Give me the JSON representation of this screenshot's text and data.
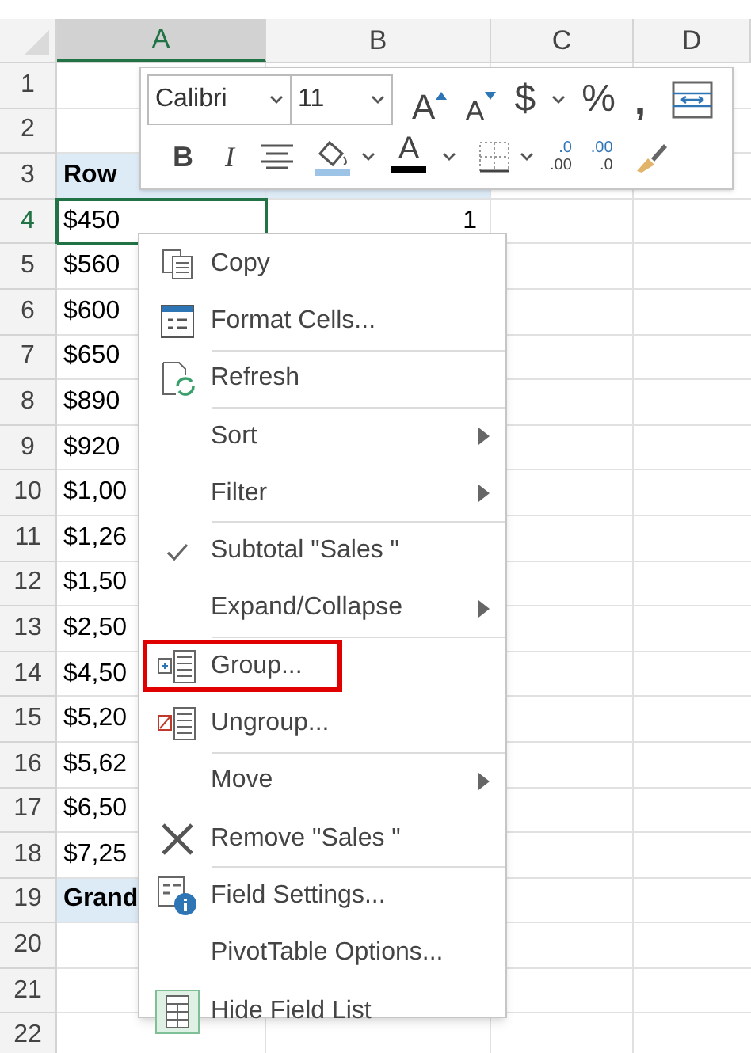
{
  "columns": [
    {
      "label": "A",
      "selected": true
    },
    {
      "label": "B",
      "selected": false
    },
    {
      "label": "C",
      "selected": false
    },
    {
      "label": "D",
      "selected": false
    }
  ],
  "rows": [
    {
      "number": "1",
      "kind": "plain",
      "selected": false
    },
    {
      "number": "2",
      "kind": "plain",
      "selected": false
    },
    {
      "number": "3",
      "kind": "heading",
      "selected": false,
      "a": "Row"
    },
    {
      "number": "4",
      "kind": "plain",
      "selected": true,
      "a": "$450",
      "b": "1"
    },
    {
      "number": "5",
      "kind": "plain",
      "selected": false,
      "a": "$560"
    },
    {
      "number": "6",
      "kind": "plain",
      "selected": false,
      "a": "$600"
    },
    {
      "number": "7",
      "kind": "plain",
      "selected": false,
      "a": "$650"
    },
    {
      "number": "8",
      "kind": "plain",
      "selected": false,
      "a": "$890"
    },
    {
      "number": "9",
      "kind": "plain",
      "selected": false,
      "a": "$920"
    },
    {
      "number": "10",
      "kind": "plain",
      "selected": false,
      "a": "$1,00"
    },
    {
      "number": "11",
      "kind": "plain",
      "selected": false,
      "a": "$1,26"
    },
    {
      "number": "12",
      "kind": "plain",
      "selected": false,
      "a": "$1,50"
    },
    {
      "number": "13",
      "kind": "plain",
      "selected": false,
      "a": "$2,50"
    },
    {
      "number": "14",
      "kind": "plain",
      "selected": false,
      "a": "$4,50"
    },
    {
      "number": "15",
      "kind": "plain",
      "selected": false,
      "a": "$5,20"
    },
    {
      "number": "16",
      "kind": "plain",
      "selected": false,
      "a": "$5,62"
    },
    {
      "number": "17",
      "kind": "plain",
      "selected": false,
      "a": "$6,50"
    },
    {
      "number": "18",
      "kind": "plain",
      "selected": false,
      "a": "$7,25"
    },
    {
      "number": "19",
      "kind": "heading",
      "selected": false,
      "a": "Grand"
    },
    {
      "number": "20",
      "kind": "plain",
      "selected": false
    },
    {
      "number": "21",
      "kind": "plain",
      "selected": false
    },
    {
      "number": "22",
      "kind": "plain",
      "selected": false
    }
  ],
  "mini_toolbar": {
    "font": "Calibri",
    "size": "11",
    "row_1": [
      {
        "kind": "grow",
        "label": "A"
      },
      {
        "kind": "shrink",
        "label": "A"
      },
      {
        "kind": "text",
        "label": "$"
      },
      {
        "kind": "caret"
      },
      {
        "kind": "text",
        "label": "%"
      },
      {
        "kind": "comma",
        "label": ","
      },
      {
        "kind": "wrap"
      }
    ],
    "row_2": [
      {
        "kind": "bold",
        "label": "B"
      },
      {
        "kind": "italic",
        "label": "I"
      },
      {
        "kind": "center"
      },
      {
        "kind": "fill"
      },
      {
        "kind": "caret"
      },
      {
        "kind": "fontcolor",
        "label": "A"
      },
      {
        "kind": "caret"
      },
      {
        "kind": "borders"
      },
      {
        "kind": "caret"
      },
      {
        "kind": "decimal_up",
        "top": ".0",
        "bottom": ".00"
      },
      {
        "kind": "decimal_down",
        "top": ".00",
        "bottom": ".0"
      },
      {
        "kind": "brush"
      }
    ]
  },
  "context_menu": [
    {
      "label": "Copy",
      "kind": "copy",
      "submenu": false,
      "checked": false,
      "highlighted": false,
      "separator": false
    },
    {
      "label": "Format Cells...",
      "kind": "format",
      "submenu": false,
      "checked": false,
      "highlighted": false,
      "separator": true
    },
    {
      "label": "Refresh",
      "kind": "refresh",
      "submenu": false,
      "checked": false,
      "highlighted": false,
      "separator": true
    },
    {
      "label": "Sort",
      "kind": "plain",
      "submenu": true,
      "checked": false,
      "highlighted": false,
      "separator": false
    },
    {
      "label": "Filter",
      "kind": "plain",
      "submenu": true,
      "checked": false,
      "highlighted": false,
      "separator": true
    },
    {
      "label": "Subtotal \"Sales \"",
      "kind": "plain",
      "submenu": false,
      "checked": true,
      "highlighted": false,
      "separator": false
    },
    {
      "label": "Expand/Collapse",
      "kind": "plain",
      "submenu": true,
      "checked": false,
      "highlighted": false,
      "separator": true
    },
    {
      "label": "Group...",
      "kind": "group",
      "submenu": false,
      "checked": false,
      "highlighted": true,
      "separator": false
    },
    {
      "label": "Ungroup...",
      "kind": "ungroup",
      "submenu": false,
      "checked": false,
      "highlighted": false,
      "separator": true
    },
    {
      "label": "Move",
      "kind": "plain",
      "submenu": true,
      "checked": false,
      "highlighted": false,
      "separator": false
    },
    {
      "label": "Remove \"Sales \"",
      "kind": "remove",
      "submenu": false,
      "checked": false,
      "highlighted": false,
      "separator": true
    },
    {
      "label": "Field Settings...",
      "kind": "settings",
      "submenu": false,
      "checked": false,
      "highlighted": false,
      "separator": false
    },
    {
      "label": "PivotTable Options...",
      "kind": "plain",
      "submenu": false,
      "checked": false,
      "highlighted": false,
      "separator": false
    },
    {
      "label": "Hide Field List",
      "kind": "fieldlist",
      "submenu": false,
      "checked": false,
      "highlighted": false,
      "separator": false
    }
  ]
}
